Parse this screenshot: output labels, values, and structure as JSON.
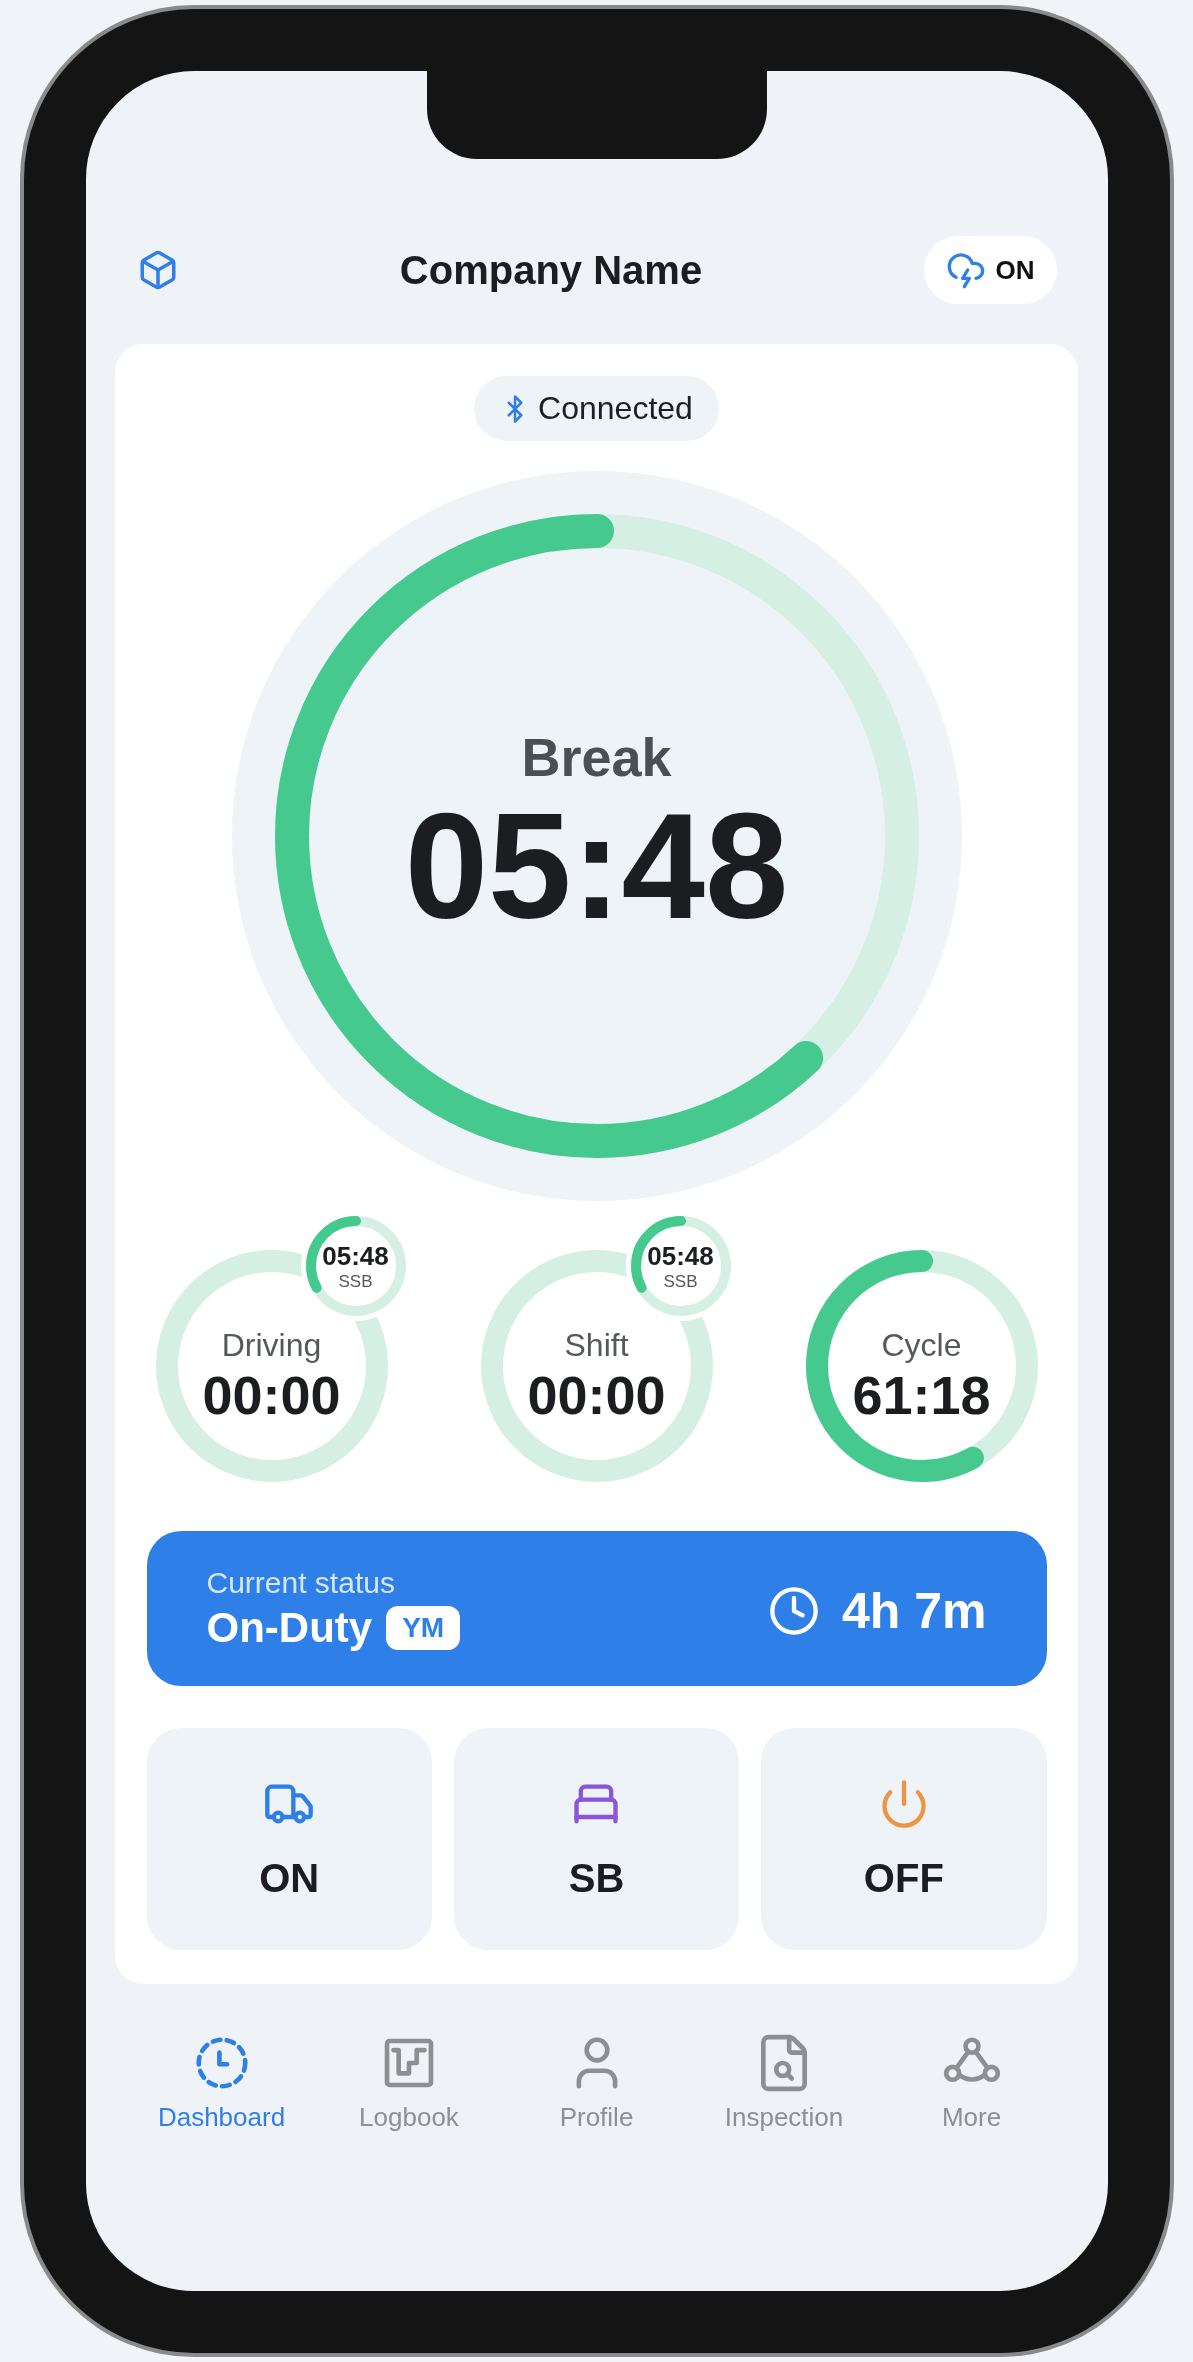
{
  "header": {
    "title": "Company Name",
    "sync_label": "ON"
  },
  "connection": {
    "label": "Connected"
  },
  "main_timer": {
    "label": "Break",
    "value": "05:48",
    "level": 0.62
  },
  "clocks": [
    {
      "label": "Driving",
      "value": "00:00",
      "badge": {
        "value": "05:48",
        "label": "SSB",
        "level": 0.33
      }
    },
    {
      "label": "Shift",
      "value": "00:00",
      "badge": {
        "value": "05:48",
        "label": "SSB",
        "level": 0.33
      }
    },
    {
      "label": "Cycle",
      "value": "61:18",
      "level": 0.58
    }
  ],
  "status": {
    "caption": "Current status",
    "value": "On-Duty",
    "tag": "YM",
    "duration": "4h 7m"
  },
  "actions": [
    {
      "kind": "on",
      "label": "ON"
    },
    {
      "kind": "sleeper",
      "label": "SB"
    },
    {
      "kind": "off",
      "label": "OFF"
    }
  ],
  "nav": [
    {
      "kind": "dashboard",
      "label": "Dashboard",
      "selected": true
    },
    {
      "kind": "logbook",
      "label": "Logbook",
      "selected": false
    },
    {
      "kind": "profile",
      "label": "Profile",
      "selected": false
    },
    {
      "kind": "inspection",
      "label": "Inspection",
      "selected": false
    },
    {
      "kind": "more",
      "label": "More",
      "selected": false
    }
  ]
}
